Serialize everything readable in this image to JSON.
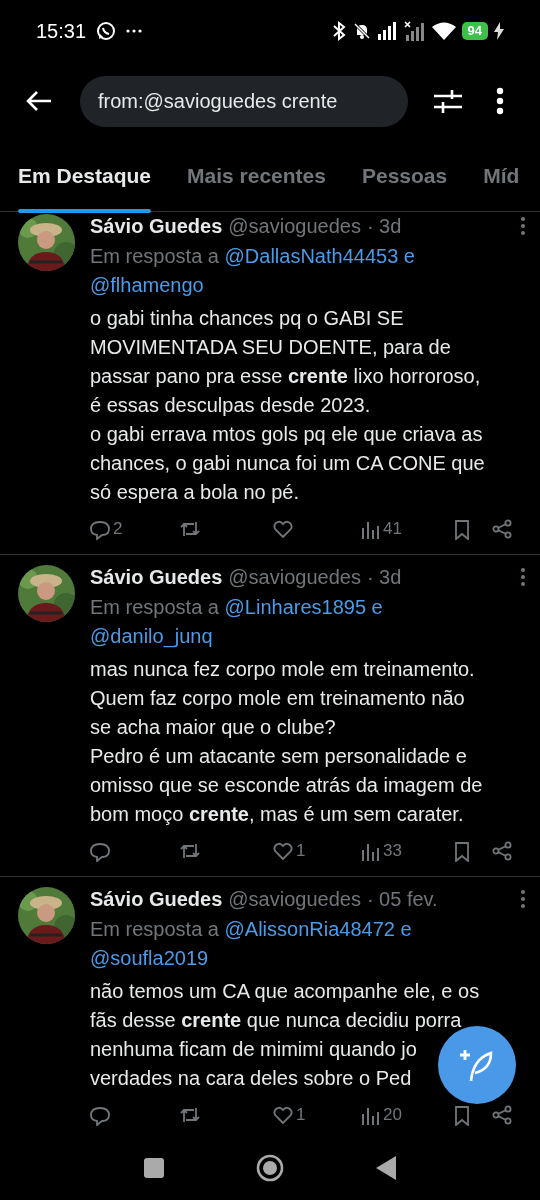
{
  "status_bar": {
    "time": "15:31",
    "battery": "94"
  },
  "search": {
    "value": "from:@savioguedes crente"
  },
  "tabs": [
    {
      "label": "Em Destaque",
      "selected": true
    },
    {
      "label": "Mais recentes",
      "selected": false
    },
    {
      "label": "Pessoas",
      "selected": false
    },
    {
      "label": "Míd",
      "selected": false
    }
  ],
  "tweets": [
    {
      "name": "Sávio Guedes",
      "handle": "@savioguedes",
      "date": "· 3d",
      "reply": {
        "prefix": "Em resposta a",
        "mentions": [
          "@DallasNath44453",
          "@flhamengo"
        ],
        "joiner": "e"
      },
      "body": [
        "o gabi tinha chances pq o GABI SE",
        "MOVIMENTADA SEU DOENTE, para de",
        "passar pano pra esse **crente** lixo horroroso,",
        "é essas desculpas desde 2023.",
        "o gabi errava mtos gols pq ele que criava as",
        "chances, o gabi nunca foi um CA CONE que",
        "só espera a bola no pé."
      ],
      "replies": "2",
      "views": "41"
    },
    {
      "name": "Sávio Guedes",
      "handle": "@savioguedes",
      "date": "· 3d",
      "reply": {
        "prefix": "Em resposta a",
        "mentions": [
          "@Linhares1895",
          "@danilo_junq"
        ],
        "joiner": "e"
      },
      "body": [
        "mas nunca fez corpo mole em treinamento.",
        "Quem faz corpo mole em treinamento não",
        "se acha maior que o clube?",
        "Pedro é um atacante sem personalidade e",
        "omisso que se esconde atrás da imagem de",
        "bom moço **crente**, mas é um sem carater."
      ],
      "likes": "1",
      "views": "33"
    },
    {
      "name": "Sávio Guedes",
      "handle": "@savioguedes",
      "date": "· 05 fev.",
      "reply": {
        "prefix": "Em resposta a",
        "mentions": [
          "@AlissonRia48472",
          "@soufla2019"
        ],
        "joiner": "e"
      },
      "body": [
        "não temos um CA que acompanhe ele, e os",
        "fãs desse **crente** que nunca decidiu porra",
        "nenhuma ficam de mimimi quando jo",
        "verdades na cara deles sobre o Ped"
      ],
      "likes": "1",
      "views": "20"
    }
  ]
}
